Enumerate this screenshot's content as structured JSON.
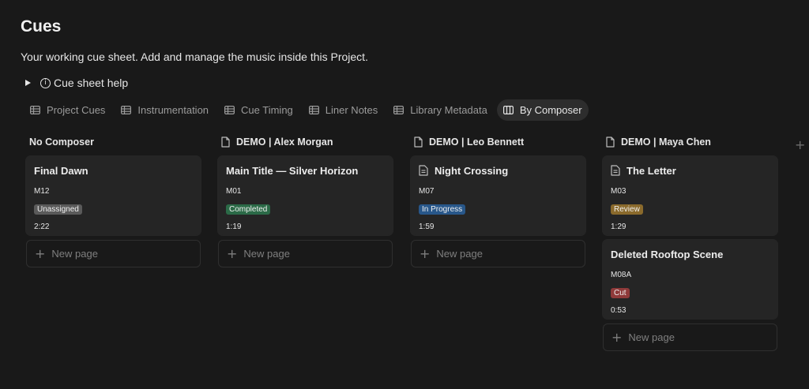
{
  "page": {
    "title": "Cues",
    "subtitle": "Your working cue sheet. Add and manage the music inside this Project.",
    "help_label": "Cue sheet help"
  },
  "tabs": [
    {
      "label": "Project Cues",
      "icon": "table-icon"
    },
    {
      "label": "Instrumentation",
      "icon": "table-icon"
    },
    {
      "label": "Cue Timing",
      "icon": "table-icon"
    },
    {
      "label": "Liner Notes",
      "icon": "table-icon"
    },
    {
      "label": "Library Metadata",
      "icon": "table-icon"
    },
    {
      "label": "By Composer",
      "icon": "board-icon",
      "active": true
    }
  ],
  "columns": [
    {
      "title": "No Composer",
      "cards": [
        {
          "title": "Final Dawn",
          "cue": "M12",
          "status": "Unassigned",
          "status_color": "#5a5a5a",
          "duration": "2:22"
        }
      ],
      "new_page": "New page"
    },
    {
      "title": "DEMO | Alex Morgan",
      "cards": [
        {
          "title": "Main Title — Silver Horizon",
          "cue": "M01",
          "status": "Completed",
          "status_color": "#2b6a47",
          "duration": "1:19"
        }
      ],
      "new_page": "New page"
    },
    {
      "title": "DEMO | Leo Bennett",
      "cards": [
        {
          "title": "Night Crossing",
          "cue": "M07",
          "status": "In Progress",
          "status_color": "#28578a",
          "duration": "1:59"
        }
      ],
      "new_page": "New page"
    },
    {
      "title": "DEMO | Maya Chen",
      "cards": [
        {
          "title": "The Letter",
          "cue": "M03",
          "status": "Review",
          "status_color": "#8a6a2c",
          "duration": "1:29"
        },
        {
          "title": "Deleted Rooftop Scene",
          "cue": "M08A",
          "status": "Cut",
          "status_color": "#8f3a3a",
          "duration": "0:53"
        }
      ],
      "new_page": "New page"
    }
  ],
  "add_group_icon": "plus-icon"
}
